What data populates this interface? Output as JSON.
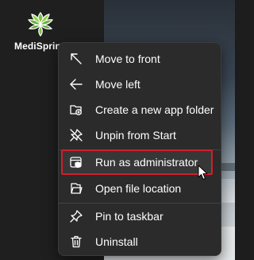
{
  "app": {
    "label": "MediSprin",
    "logo_icon": "lotus-flower-icon",
    "logo_color": "#7cc242"
  },
  "menu": {
    "items": [
      {
        "label": "Move to front",
        "icon": "arrow-up-left-icon"
      },
      {
        "label": "Move left",
        "icon": "arrow-left-icon"
      },
      {
        "label": "Create a new app folder",
        "icon": "folder-add-icon"
      },
      {
        "label": "Unpin from Start",
        "icon": "unpin-icon"
      },
      {
        "label": "Run as administrator",
        "icon": "shield-window-icon",
        "highlighted": true
      },
      {
        "label": "Open file location",
        "icon": "folder-open-icon"
      },
      {
        "label": "Pin to taskbar",
        "icon": "pin-icon"
      },
      {
        "label": "Uninstall",
        "icon": "trash-icon"
      }
    ],
    "highlight_color": "#d0202a"
  }
}
